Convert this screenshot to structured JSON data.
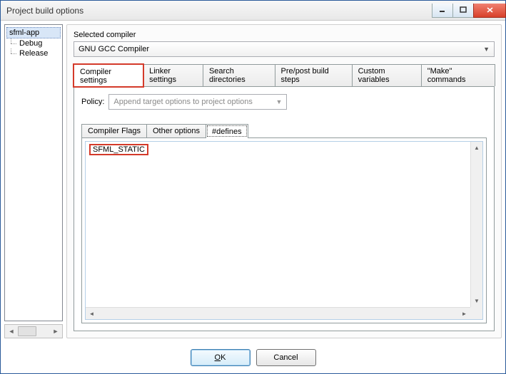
{
  "window": {
    "title": "Project build options"
  },
  "tree": {
    "root": "sfml-app",
    "items": [
      "Debug",
      "Release"
    ]
  },
  "main": {
    "compiler_label": "Selected compiler",
    "compiler_value": "GNU GCC Compiler",
    "tabs": [
      "Compiler settings",
      "Linker settings",
      "Search directories",
      "Pre/post build steps",
      "Custom variables",
      "\"Make\" commands"
    ],
    "active_tab_index": 0,
    "policy": {
      "label": "Policy:",
      "value": "Append target options to project options"
    },
    "inner_tabs": [
      "Compiler Flags",
      "Other options",
      "#defines"
    ],
    "inner_active_index": 2,
    "defines_text": "SFML_STATIC"
  },
  "buttons": {
    "ok": "OK",
    "cancel": "Cancel"
  }
}
